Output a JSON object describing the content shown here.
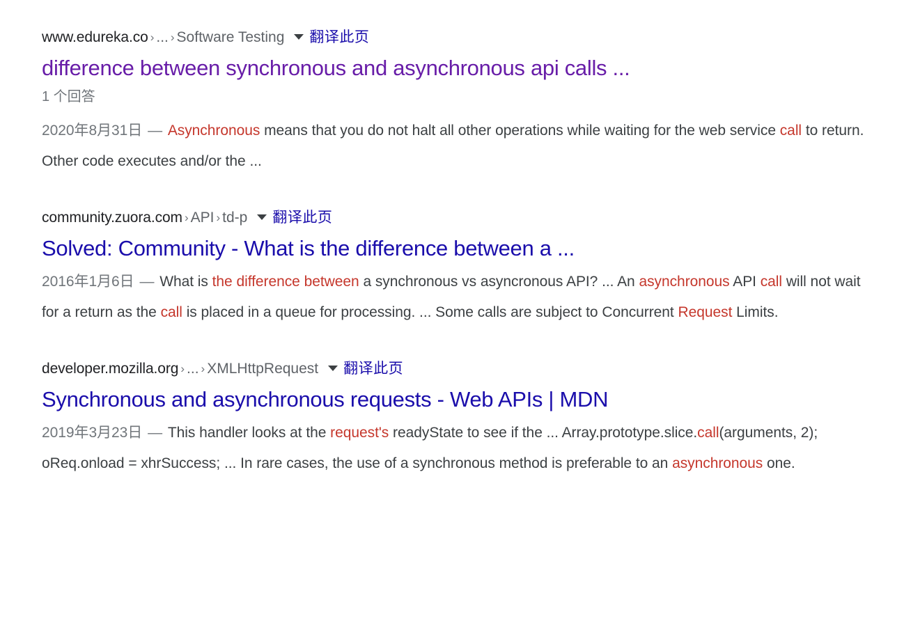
{
  "page": {
    "background": "#ffffff",
    "link_color_unvisited": "#1a0dab",
    "link_color_visited": "#681da8",
    "highlight_color": "#c5372c",
    "url_domain_color": "#202124",
    "url_path_color": "#5f6368",
    "snippet_color": "#3c4043",
    "date_color": "#70757a"
  },
  "results": [
    {
      "url": {
        "domain": "www.edureka.co",
        "sep1": "›",
        "crumb1": "...",
        "sep2": "›",
        "crumb2": "Software Testing"
      },
      "translate_label": "翻译此页",
      "title": "difference between synchronous and asynchronous api calls ...",
      "visited": true,
      "meta": "1 个回答",
      "snippet": {
        "date": "2020年8月31日",
        "dash": "—",
        "parts": [
          {
            "text": "Asynchronous",
            "highlight": true
          },
          {
            "text": " means that you do not halt all other operations while waiting for the web service ",
            "highlight": false
          },
          {
            "text": "call",
            "highlight": true
          },
          {
            "text": " to return. Other code executes and/or the ...",
            "highlight": false
          }
        ]
      }
    },
    {
      "url": {
        "domain": "community.zuora.com",
        "sep1": "›",
        "crumb1": "API",
        "sep2": "›",
        "crumb2": "td-p"
      },
      "translate_label": "翻译此页",
      "title": "Solved: Community - What is the difference between a ...",
      "visited": false,
      "meta": "",
      "snippet": {
        "date": "2016年1月6日",
        "dash": "—",
        "parts": [
          {
            "text": "What is ",
            "highlight": false
          },
          {
            "text": "the difference between",
            "highlight": true
          },
          {
            "text": " a synchronous vs asyncronous API? ... An ",
            "highlight": false
          },
          {
            "text": "asynchronous",
            "highlight": true
          },
          {
            "text": " API ",
            "highlight": false
          },
          {
            "text": "call",
            "highlight": true
          },
          {
            "text": " will not wait for a return as the ",
            "highlight": false
          },
          {
            "text": "call",
            "highlight": true
          },
          {
            "text": " is placed in a queue for processing. ... Some calls are subject to Concurrent ",
            "highlight": false
          },
          {
            "text": "Request",
            "highlight": true
          },
          {
            "text": " Limits.",
            "highlight": false
          }
        ]
      }
    },
    {
      "url": {
        "domain": "developer.mozilla.org",
        "sep1": "›",
        "crumb1": "...",
        "sep2": "›",
        "crumb2": "XMLHttpRequest"
      },
      "translate_label": "翻译此页",
      "title": "Synchronous and asynchronous requests - Web APIs | MDN",
      "visited": false,
      "meta": "",
      "snippet": {
        "date": "2019年3月23日",
        "dash": "—",
        "parts": [
          {
            "text": "This handler looks at the ",
            "highlight": false
          },
          {
            "text": "request's",
            "highlight": true
          },
          {
            "text": " readyState to see if the ... Array.prototype.slice.",
            "highlight": false
          },
          {
            "text": "call",
            "highlight": true
          },
          {
            "text": "(arguments, 2); oReq.onload = xhrSuccess; ... In rare cases, the use of a synchronous method is preferable to an ",
            "highlight": false
          },
          {
            "text": "asynchronous",
            "highlight": true
          },
          {
            "text": " one.",
            "highlight": false
          }
        ]
      }
    }
  ],
  "icons": {
    "dropdown": "chevron-down-icon"
  }
}
